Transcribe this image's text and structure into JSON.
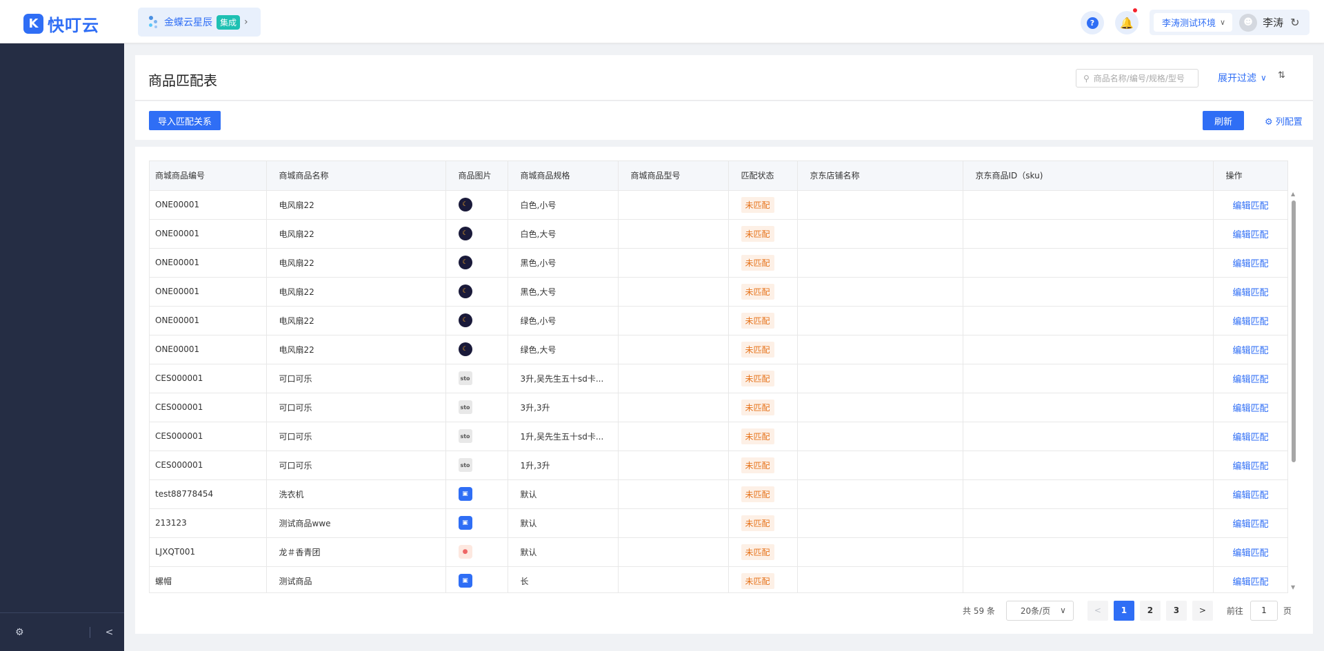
{
  "topbar": {
    "logo_text": "快叮云",
    "app_name": "金蝶云星辰",
    "app_tag": "集成",
    "env_name": "李涛测试环境",
    "username": "李涛"
  },
  "header": {
    "title": "商品匹配表",
    "search_placeholder": "商品名称/编号/规格/型号",
    "expand_filter": "展开过滤"
  },
  "toolbar": {
    "import_label": "导入匹配关系",
    "refresh_label": "刷新",
    "column_config_label": "列配置"
  },
  "table": {
    "columns": [
      "商城商品编号",
      "商城商品名称",
      "商品图片",
      "商城商品规格",
      "商城商品型号",
      "匹配状态",
      "京东店铺名称",
      "京东商品ID（sku)",
      "操作"
    ],
    "rows": [
      {
        "code": "ONE00001",
        "name": "电风扇22",
        "img": "fan",
        "spec": "白色,小号",
        "model": "",
        "status": "未匹配",
        "shop": "",
        "sku": "",
        "op": "编辑匹配"
      },
      {
        "code": "ONE00001",
        "name": "电风扇22",
        "img": "fan",
        "spec": "白色,大号",
        "model": "",
        "status": "未匹配",
        "shop": "",
        "sku": "",
        "op": "编辑匹配"
      },
      {
        "code": "ONE00001",
        "name": "电风扇22",
        "img": "fan",
        "spec": "黑色,小号",
        "model": "",
        "status": "未匹配",
        "shop": "",
        "sku": "",
        "op": "编辑匹配"
      },
      {
        "code": "ONE00001",
        "name": "电风扇22",
        "img": "fan",
        "spec": "黑色,大号",
        "model": "",
        "status": "未匹配",
        "shop": "",
        "sku": "",
        "op": "编辑匹配"
      },
      {
        "code": "ONE00001",
        "name": "电风扇22",
        "img": "fan",
        "spec": "绿色,小号",
        "model": "",
        "status": "未匹配",
        "shop": "",
        "sku": "",
        "op": "编辑匹配"
      },
      {
        "code": "ONE00001",
        "name": "电风扇22",
        "img": "fan",
        "spec": "绿色,大号",
        "model": "",
        "status": "未匹配",
        "shop": "",
        "sku": "",
        "op": "编辑匹配"
      },
      {
        "code": "CES000001",
        "name": "可口可乐",
        "img": "sto",
        "spec": "3升,吴先生五十sd卡...",
        "model": "",
        "status": "未匹配",
        "shop": "",
        "sku": "",
        "op": "编辑匹配"
      },
      {
        "code": "CES000001",
        "name": "可口可乐",
        "img": "sto",
        "spec": "3升,3升",
        "model": "",
        "status": "未匹配",
        "shop": "",
        "sku": "",
        "op": "编辑匹配"
      },
      {
        "code": "CES000001",
        "name": "可口可乐",
        "img": "sto",
        "spec": "1升,吴先生五十sd卡...",
        "model": "",
        "status": "未匹配",
        "shop": "",
        "sku": "",
        "op": "编辑匹配"
      },
      {
        "code": "CES000001",
        "name": "可口可乐",
        "img": "sto",
        "spec": "1升,3升",
        "model": "",
        "status": "未匹配",
        "shop": "",
        "sku": "",
        "op": "编辑匹配"
      },
      {
        "code": "test88778454",
        "name": "洗衣机",
        "img": "blue",
        "spec": "默认",
        "model": "",
        "status": "未匹配",
        "shop": "",
        "sku": "",
        "op": "编辑匹配"
      },
      {
        "code": "213123",
        "name": "测试商品wwe",
        "img": "blue",
        "spec": "默认",
        "model": "",
        "status": "未匹配",
        "shop": "",
        "sku": "",
        "op": "编辑匹配"
      },
      {
        "code": "LJXQT001",
        "name": "龙＃香青团",
        "img": "pink",
        "spec": "默认",
        "model": "",
        "status": "未匹配",
        "shop": "",
        "sku": "",
        "op": "编辑匹配"
      },
      {
        "code": "螺帽",
        "name": "测试商品",
        "img": "blue",
        "spec": "长",
        "model": "",
        "status": "未匹配",
        "shop": "",
        "sku": "",
        "op": "编辑匹配"
      }
    ]
  },
  "pagination": {
    "total": "共 59 条",
    "page_size": "20条/页",
    "pages": [
      "1",
      "2",
      "3"
    ],
    "active_page": "1",
    "goto_label": "前往",
    "goto_value": "1",
    "unit": "页"
  },
  "colors": {
    "primary": "#2f6ef5",
    "sidebar": "#252d44",
    "status_text": "#e6731b",
    "status_bg": "#fdf0e6"
  },
  "icons": [
    "search-icon",
    "chevron-down-icon",
    "sort-icon",
    "gear-icon",
    "question-icon",
    "bell-icon",
    "refresh-icon",
    "collapse-icon"
  ]
}
